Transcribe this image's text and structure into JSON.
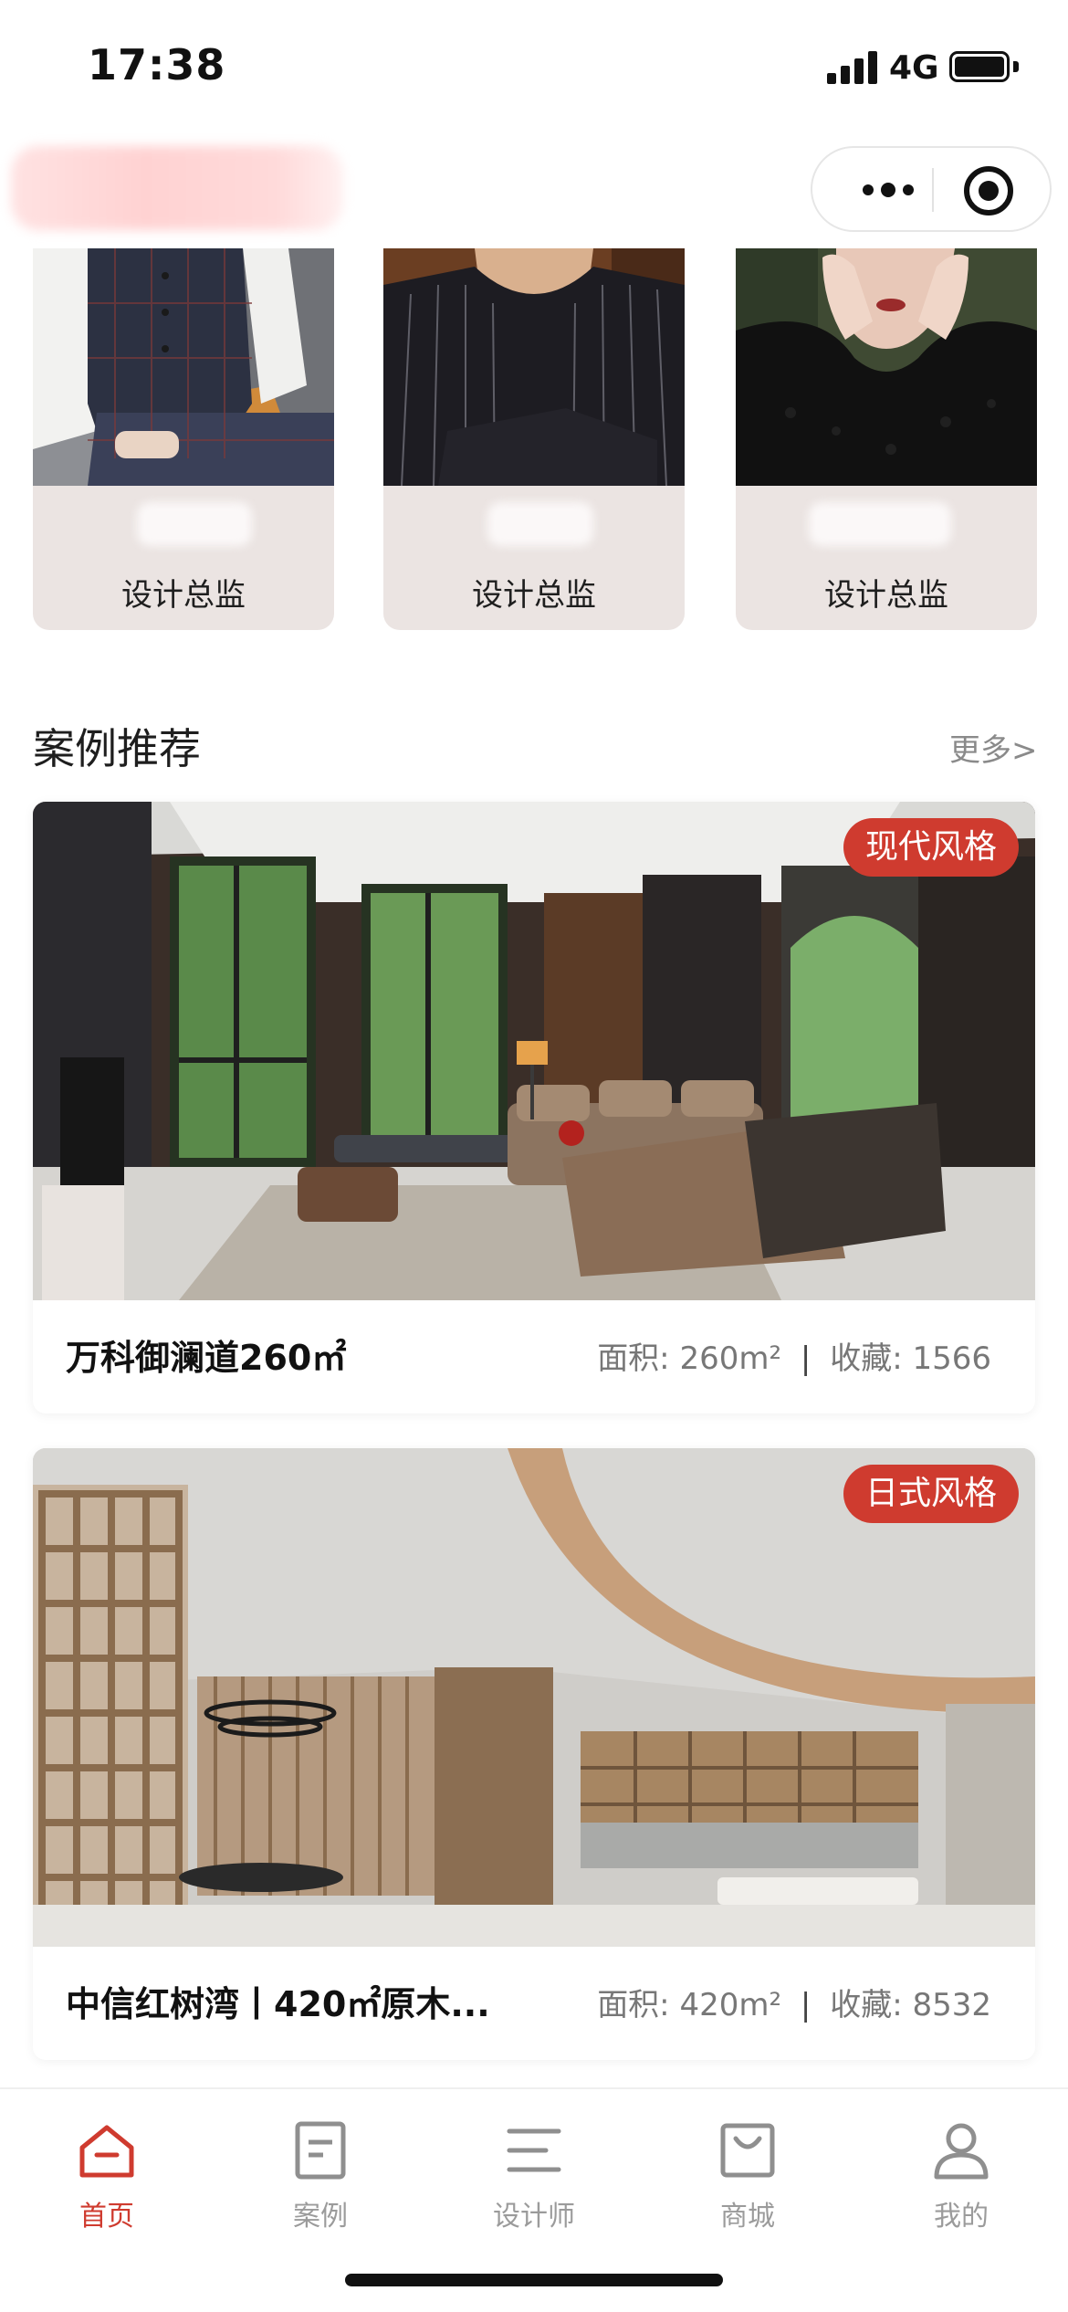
{
  "status_bar": {
    "time": "17:38",
    "network": "4G",
    "signal_bars": 4,
    "battery_level": 1.0
  },
  "header": {
    "menu_icon": "ellipsis-icon",
    "close_icon": "target-circle-icon"
  },
  "designers": [
    {
      "role": "设计总监",
      "photo": "designer-photo-1"
    },
    {
      "role": "设计总监",
      "photo": "designer-photo-2"
    },
    {
      "role": "设计总监",
      "photo": "designer-photo-3"
    }
  ],
  "section": {
    "title": "案例推荐",
    "more_label": "更多>"
  },
  "cases": [
    {
      "badge": "现代风格",
      "title": "万科御澜道260㎡",
      "area_label": "面积: 260m²",
      "fav_label": "收藏: 1566",
      "separator": "|"
    },
    {
      "badge": "日式风格",
      "title": "中信红树湾丨420㎡原木...",
      "area_label": "面积: 420m²",
      "fav_label": "收藏: 8532",
      "separator": "|"
    }
  ],
  "tabs": [
    {
      "label": "首页",
      "icon": "home-icon",
      "active": true
    },
    {
      "label": "案例",
      "icon": "document-icon",
      "active": false
    },
    {
      "label": "设计师",
      "icon": "menu-lines-icon",
      "active": false
    },
    {
      "label": "商城",
      "icon": "shopping-bag-icon",
      "active": false
    },
    {
      "label": "我的",
      "icon": "profile-icon",
      "active": false
    }
  ],
  "colors": {
    "accent": "#cf3b2f",
    "card_bg": "#ebe4e2",
    "muted": "#9b9b9b"
  }
}
